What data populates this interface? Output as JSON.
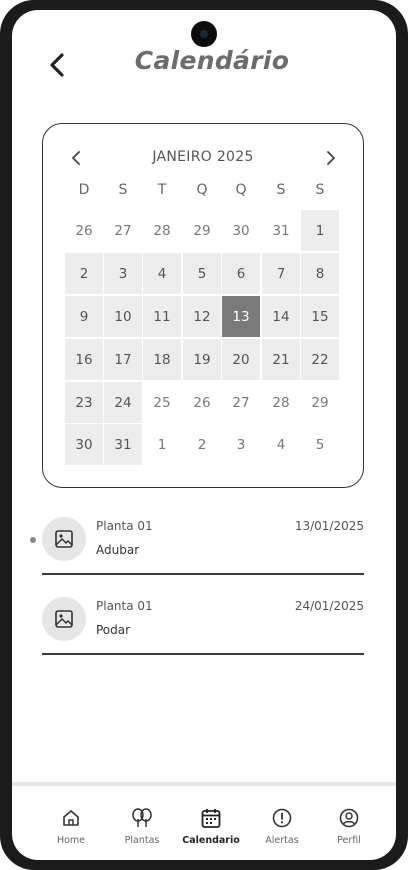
{
  "header": {
    "title": "Calendário",
    "back_icon": "chevron-left-icon"
  },
  "calendar": {
    "month_label": "JANEIRO 2025",
    "prev_icon": "chevron-left-icon",
    "next_icon": "chevron-right-icon",
    "weekdays": [
      "D",
      "S",
      "T",
      "Q",
      "Q",
      "S",
      "S"
    ],
    "selected_day": "13",
    "weeks": [
      [
        {
          "d": "26",
          "m": false
        },
        {
          "d": "27",
          "m": false
        },
        {
          "d": "28",
          "m": false
        },
        {
          "d": "29",
          "m": false
        },
        {
          "d": "30",
          "m": false
        },
        {
          "d": "31",
          "m": false
        },
        {
          "d": "1",
          "m": true
        }
      ],
      [
        {
          "d": "2",
          "m": true
        },
        {
          "d": "3",
          "m": true
        },
        {
          "d": "4",
          "m": true
        },
        {
          "d": "5",
          "m": true
        },
        {
          "d": "6",
          "m": true
        },
        {
          "d": "7",
          "m": true
        },
        {
          "d": "8",
          "m": true
        }
      ],
      [
        {
          "d": "9",
          "m": true
        },
        {
          "d": "10",
          "m": true
        },
        {
          "d": "11",
          "m": true
        },
        {
          "d": "12",
          "m": true
        },
        {
          "d": "13",
          "m": true
        },
        {
          "d": "14",
          "m": true
        },
        {
          "d": "15",
          "m": true
        }
      ],
      [
        {
          "d": "16",
          "m": true
        },
        {
          "d": "17",
          "m": true
        },
        {
          "d": "18",
          "m": true
        },
        {
          "d": "19",
          "m": true
        },
        {
          "d": "20",
          "m": true
        },
        {
          "d": "21",
          "m": true
        },
        {
          "d": "22",
          "m": true
        }
      ],
      [
        {
          "d": "23",
          "m": true
        },
        {
          "d": "24",
          "m": true
        },
        {
          "d": "25",
          "m": false
        },
        {
          "d": "26",
          "m": false
        },
        {
          "d": "27",
          "m": false
        },
        {
          "d": "28",
          "m": false
        },
        {
          "d": "29",
          "m": false
        }
      ],
      [
        {
          "d": "30",
          "m": true
        },
        {
          "d": "31",
          "m": true
        },
        {
          "d": "1",
          "m": false
        },
        {
          "d": "2",
          "m": false
        },
        {
          "d": "3",
          "m": false
        },
        {
          "d": "4",
          "m": false
        },
        {
          "d": "5",
          "m": false
        }
      ]
    ]
  },
  "events": [
    {
      "plant": "Planta 01",
      "date": "13/01/2025",
      "task": "Adubar",
      "icon": "image-icon"
    },
    {
      "plant": "Planta 01",
      "date": "24/01/2025",
      "task": "Podar",
      "icon": "image-icon"
    }
  ],
  "nav": {
    "items": [
      {
        "label": "Home",
        "icon": "home-icon"
      },
      {
        "label": "Plantas",
        "icon": "trees-icon"
      },
      {
        "label": "Calendario",
        "icon": "calendar-icon"
      },
      {
        "label": "Alertas",
        "icon": "alert-circle-icon"
      },
      {
        "label": "Perfil",
        "icon": "user-circle-icon"
      }
    ],
    "active": "Calendario"
  }
}
